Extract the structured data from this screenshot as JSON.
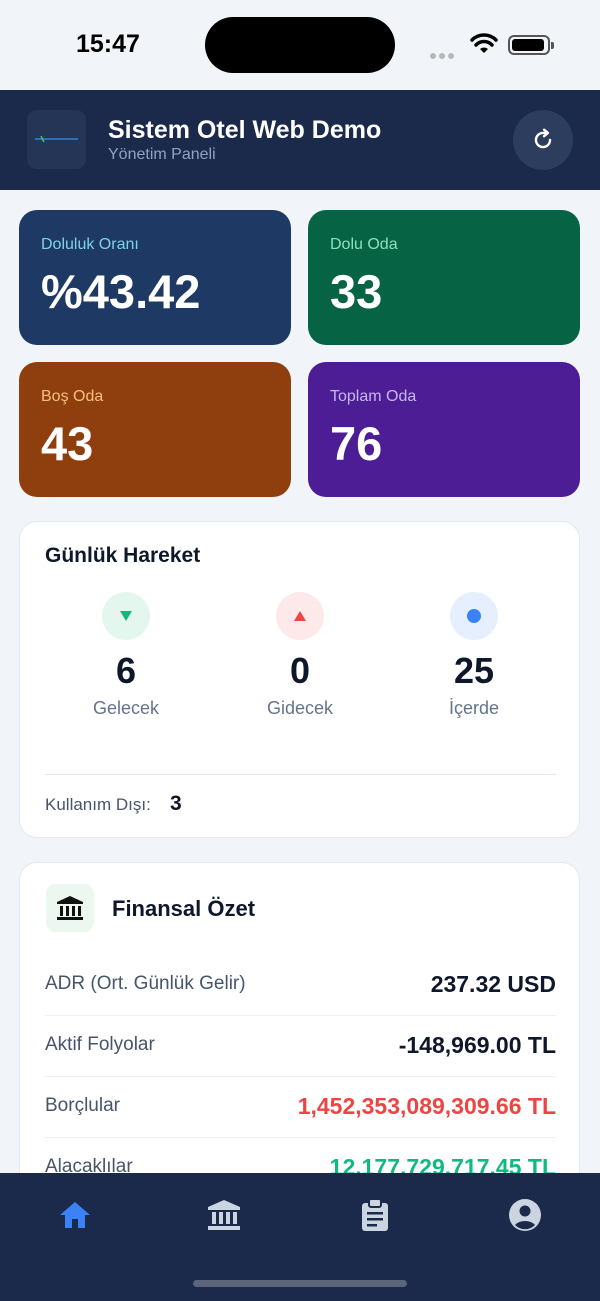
{
  "status_bar": {
    "time": "15:47"
  },
  "header": {
    "title": "Sistem Otel Web Demo",
    "subtitle": "Yönetim Paneli",
    "logo_icon": "hotel-logo",
    "refresh_icon": "refresh-icon"
  },
  "stats": {
    "occupancy": {
      "label": "Doluluk Oranı",
      "value": "%43.42",
      "color": "#1e3a64"
    },
    "occupied": {
      "label": "Dolu Oda",
      "value": "33",
      "color": "#066344"
    },
    "vacant": {
      "label": "Boş Oda",
      "value": "43",
      "color": "#8f3f0e"
    },
    "total": {
      "label": "Toplam Oda",
      "value": "76",
      "color": "#4c1d95"
    }
  },
  "daily": {
    "title": "Günlük Hareket",
    "arriving": {
      "value": "6",
      "label": "Gelecek",
      "icon": "arrow-down-icon",
      "color": "#10b981"
    },
    "departing": {
      "value": "0",
      "label": "Gidecek",
      "icon": "arrow-up-icon",
      "color": "#ef4444"
    },
    "inhouse": {
      "value": "25",
      "label": "İçerde",
      "icon": "dot-icon",
      "color": "#3b82f6"
    },
    "out_of_service_label": "Kullanım Dışı:",
    "out_of_service_value": "3"
  },
  "finance": {
    "title": "Finansal Özet",
    "icon": "bank-icon",
    "rows": [
      {
        "label": "ADR (Ort. Günlük Gelir)",
        "value": "237.32 USD"
      },
      {
        "label": "Aktif Folyolar",
        "value": "-148,969.00 TL"
      },
      {
        "label": "Borçlular",
        "value": "1,452,353,089,309.66 TL"
      },
      {
        "label": "Alacaklılar",
        "value": "12,177,729,717.45 TL"
      }
    ]
  },
  "nav": {
    "items": [
      {
        "icon": "home-icon",
        "active": true
      },
      {
        "icon": "bank-icon",
        "active": false
      },
      {
        "icon": "clipboard-icon",
        "active": false
      },
      {
        "icon": "account-icon",
        "active": false
      }
    ],
    "active_color": "#3b82f6",
    "inactive_color": "#cbd5e1"
  }
}
